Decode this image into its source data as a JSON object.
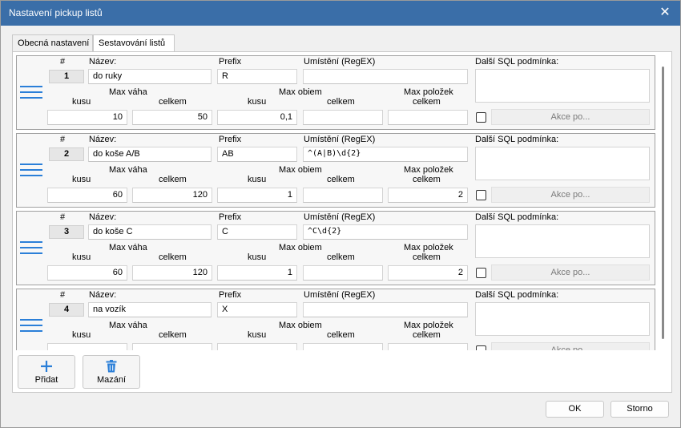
{
  "window": {
    "title": "Nastavení pickup listů",
    "close_glyph": "✕"
  },
  "tabs": [
    {
      "label": "Obecná nastavení",
      "active": false
    },
    {
      "label": "Sestavování listů",
      "active": true
    }
  ],
  "headers": {
    "num": "#",
    "name": "Název:",
    "prefix": "Prefix",
    "location": "Umístění (RegEX)",
    "sql": "Další SQL podmínka:",
    "max_weight": "Max váha",
    "max_volume": "Max obiem",
    "max_items": "Max položek",
    "per_item": "kusu",
    "total": "celkem",
    "akce": "Akce po..."
  },
  "rows": [
    {
      "num": "1",
      "name": "do ruky",
      "prefix": "R",
      "location": "",
      "sql": "",
      "weight_per_item": "10",
      "weight_total": "50",
      "volume_per_item": "0,1",
      "volume_total": "",
      "items_total": "",
      "checked": false
    },
    {
      "num": "2",
      "name": "do koše A/B",
      "prefix": "AB",
      "location": "^(A|B)\\d{2}",
      "sql": "",
      "weight_per_item": "60",
      "weight_total": "120",
      "volume_per_item": "1",
      "volume_total": "",
      "items_total": "2",
      "checked": false
    },
    {
      "num": "3",
      "name": "do koše C",
      "prefix": "C",
      "location": "^C\\d{2}",
      "sql": "",
      "weight_per_item": "60",
      "weight_total": "120",
      "volume_per_item": "1",
      "volume_total": "",
      "items_total": "2",
      "checked": false
    },
    {
      "num": "4",
      "name": "na vozík",
      "prefix": "X",
      "location": "",
      "sql": "",
      "weight_per_item": "",
      "weight_total": "",
      "volume_per_item": "",
      "volume_total": "",
      "items_total": "",
      "checked": false
    }
  ],
  "actions": {
    "add_label": "Přidat",
    "add_icon": "plus-icon",
    "delete_label": "Mazání",
    "delete_icon": "trash-icon"
  },
  "dialog": {
    "ok_label": "OK",
    "cancel_label": "Storno"
  },
  "colors": {
    "titlebar": "#3a6ea8",
    "accent": "#2b7fd8"
  }
}
